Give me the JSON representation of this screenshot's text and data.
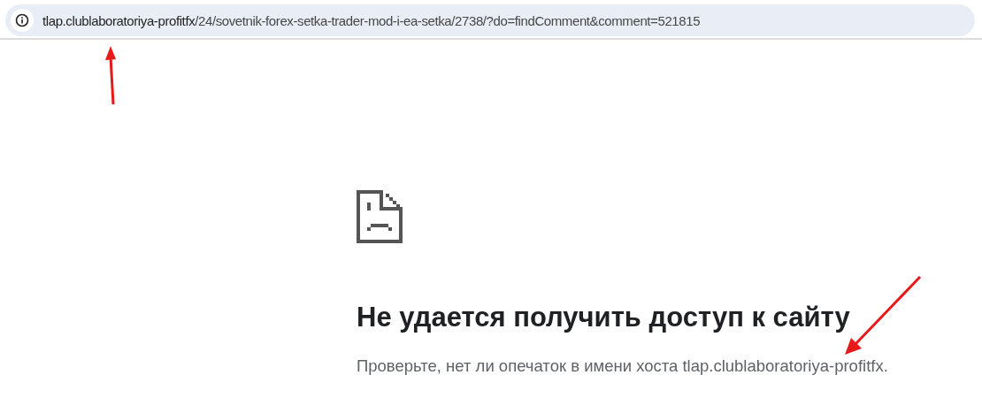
{
  "address_bar": {
    "host": "tlap.clublaboratoriya-profitfx",
    "path": "/24/sovetnik-forex-setka-trader-mod-i-ea-setka/2738/?do=findComment&comment=521815"
  },
  "error": {
    "title": "Не удается получить доступ к сайту",
    "message": "Проверьте, нет ли опечаток в имени хоста tlap.clublaboratoriya-profitfx."
  }
}
